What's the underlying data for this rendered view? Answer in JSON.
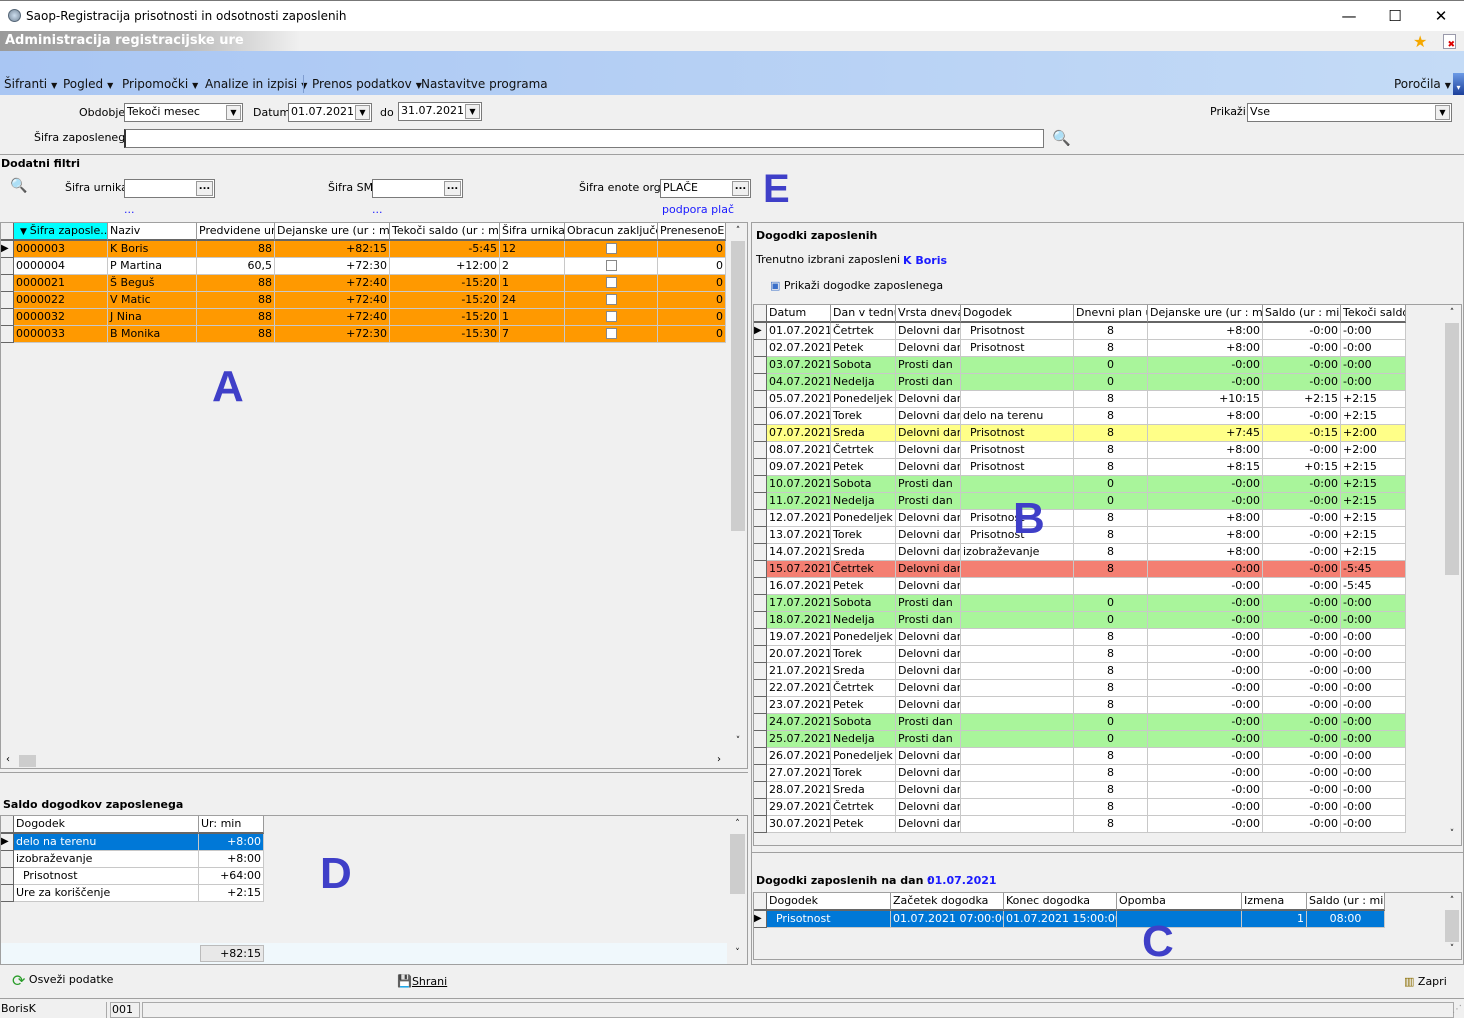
{
  "window": {
    "title": "Saop-Registracija prisotnosti in odsotnosti zaposlenih",
    "minimize": "—",
    "maximize": "☐",
    "close": "✕"
  },
  "header": {
    "title": "Administracija registracijske ure"
  },
  "menu": {
    "items": [
      "Šifranti",
      "Pogled",
      "Pripomočki",
      "Analize in izpisi",
      "Prenos podatkov",
      "Nastavitve programa"
    ],
    "right": "Poročila"
  },
  "filters": {
    "obdobje_label": "Obdobje",
    "obdobje_value": "Tekoči mesec",
    "datum_label": "Datum",
    "datum_from": "01.07.2021",
    "do_label": "do",
    "datum_to": "31.07.2021",
    "prikazi_label": "Prikaži",
    "prikazi_value": "Vse",
    "sifra_zap_label": "Šifra zaposlenega",
    "sifra_zap_value": ""
  },
  "extra_filters": {
    "title": "Dodatni filtri",
    "urnik_label": "Šifra urnika",
    "urnik_value": "",
    "urnik_desc": "...",
    "sm_label": "Šifra SM",
    "sm_value": "",
    "sm_desc": "...",
    "enota_label": "Šifra enote org.",
    "enota_value": "PLAČE",
    "enota_desc": "podpora plač"
  },
  "annotations": {
    "a": "A",
    "b": "B",
    "c": "C",
    "d": "D",
    "e": "E"
  },
  "colors": {
    "orange": "#ff9900",
    "green": "#a9f59b",
    "yellow": "#ffff88",
    "red": "#f47f72",
    "selected": "#0078d7",
    "sort_header": "#00ffff"
  },
  "employees": {
    "columns": [
      "Šifra zaposle...",
      "Naziv",
      "Predvidene ure",
      "Dejanske ure (ur : min)",
      "Tekoči saldo (ur : min)",
      "Šifra urnika",
      "Obracun zaključen",
      "PrenesenoEP"
    ],
    "rows": [
      {
        "cells": [
          "0000003",
          "K Boris",
          "88",
          "+82:15",
          "-5:45",
          "12",
          "",
          "0"
        ],
        "color": "orange",
        "selected": true
      },
      {
        "cells": [
          "0000004",
          "P Martina",
          "60,5",
          "+72:30",
          "+12:00",
          "2",
          "",
          "0"
        ],
        "color": "white"
      },
      {
        "cells": [
          "0000021",
          "Š Beguš",
          "88",
          "+72:40",
          "-15:20",
          "1",
          "",
          "0"
        ],
        "color": "orange"
      },
      {
        "cells": [
          "0000022",
          "V Matic",
          "88",
          "+72:40",
          "-15:20",
          "24",
          "",
          "0"
        ],
        "color": "orange"
      },
      {
        "cells": [
          "0000032",
          "J Nina",
          "88",
          "+72:40",
          "-15:20",
          "1",
          "",
          "0"
        ],
        "color": "orange"
      },
      {
        "cells": [
          "0000033",
          "B Monika",
          "88",
          "+72:30",
          "-15:30",
          "7",
          "",
          "0"
        ],
        "color": "orange"
      }
    ]
  },
  "saldo": {
    "title": "Saldo dogodkov zaposlenega",
    "columns": [
      "Dogodek",
      "Ur: min"
    ],
    "rows": [
      {
        "cells": [
          "delo na terenu",
          "+8:00"
        ],
        "selected": true
      },
      {
        "cells": [
          "izobraževanje",
          "+8:00"
        ]
      },
      {
        "cells": [
          "  Prisotnost",
          "+64:00"
        ]
      },
      {
        "cells": [
          "Ure za koriščenje",
          "+2:15"
        ]
      }
    ],
    "total": "+82:15"
  },
  "events": {
    "title": "Dogodki zaposlenih",
    "current_label": "Trenutno izbrani zaposleni",
    "current_value": "K Boris",
    "show_button": "Prikaži dogodke zaposlenega",
    "columns": [
      "Datum",
      "Dan v tednu",
      "Vrsta dneva",
      "Dogodek",
      "Dnevni plan ur",
      "Dejanske ure (ur : min)",
      "Saldo (ur : min)",
      "Tekoči saldo"
    ],
    "rows": [
      {
        "cells": [
          "01.07.2021",
          "Četrtek",
          "Delovni dan",
          "  Prisotnost",
          "8",
          "+8:00",
          "-0:00",
          "-0:00"
        ],
        "color": "white",
        "selected": true
      },
      {
        "cells": [
          "02.07.2021",
          "Petek",
          "Delovni dan",
          "  Prisotnost",
          "8",
          "+8:00",
          "-0:00",
          "-0:00"
        ],
        "color": "white"
      },
      {
        "cells": [
          "03.07.2021",
          "Sobota",
          "Prosti dan",
          "",
          "0",
          "-0:00",
          "-0:00",
          "-0:00"
        ],
        "color": "green"
      },
      {
        "cells": [
          "04.07.2021",
          "Nedelja",
          "Prosti dan",
          "",
          "0",
          "-0:00",
          "-0:00",
          "-0:00"
        ],
        "color": "green"
      },
      {
        "cells": [
          "05.07.2021",
          "Ponedeljek",
          "Delovni dan",
          "",
          "8",
          "+10:15",
          "+2:15",
          "+2:15"
        ],
        "color": "white"
      },
      {
        "cells": [
          "06.07.2021",
          "Torek",
          "Delovni dan",
          "delo na terenu",
          "8",
          "+8:00",
          "-0:00",
          "+2:15"
        ],
        "color": "white"
      },
      {
        "cells": [
          "07.07.2021",
          "Sreda",
          "Delovni dan",
          "  Prisotnost",
          "8",
          "+7:45",
          "-0:15",
          "+2:00"
        ],
        "color": "yellow"
      },
      {
        "cells": [
          "08.07.2021",
          "Četrtek",
          "Delovni dan",
          "  Prisotnost",
          "8",
          "+8:00",
          "-0:00",
          "+2:00"
        ],
        "color": "white"
      },
      {
        "cells": [
          "09.07.2021",
          "Petek",
          "Delovni dan",
          "  Prisotnost",
          "8",
          "+8:15",
          "+0:15",
          "+2:15"
        ],
        "color": "white"
      },
      {
        "cells": [
          "10.07.2021",
          "Sobota",
          "Prosti dan",
          "",
          "0",
          "-0:00",
          "-0:00",
          "+2:15"
        ],
        "color": "green"
      },
      {
        "cells": [
          "11.07.2021",
          "Nedelja",
          "Prosti dan",
          "",
          "0",
          "-0:00",
          "-0:00",
          "+2:15"
        ],
        "color": "green"
      },
      {
        "cells": [
          "12.07.2021",
          "Ponedeljek",
          "Delovni dan",
          "  Prisotnost",
          "8",
          "+8:00",
          "-0:00",
          "+2:15"
        ],
        "color": "white"
      },
      {
        "cells": [
          "13.07.2021",
          "Torek",
          "Delovni dan",
          "  Prisotnost",
          "8",
          "+8:00",
          "-0:00",
          "+2:15"
        ],
        "color": "white"
      },
      {
        "cells": [
          "14.07.2021",
          "Sreda",
          "Delovni dan",
          "izobraževanje",
          "8",
          "+8:00",
          "-0:00",
          "+2:15"
        ],
        "color": "white"
      },
      {
        "cells": [
          "15.07.2021",
          "Četrtek",
          "Delovni dan",
          "",
          "8",
          "-0:00",
          "-0:00",
          "-5:45"
        ],
        "color": "red"
      },
      {
        "cells": [
          "16.07.2021",
          "Petek",
          "Delovni dan",
          "",
          "",
          "-0:00",
          "-0:00",
          "-5:45"
        ],
        "color": "white"
      },
      {
        "cells": [
          "17.07.2021",
          "Sobota",
          "Prosti dan",
          "",
          "0",
          "-0:00",
          "-0:00",
          "-0:00"
        ],
        "color": "green"
      },
      {
        "cells": [
          "18.07.2021",
          "Nedelja",
          "Prosti dan",
          "",
          "0",
          "-0:00",
          "-0:00",
          "-0:00"
        ],
        "color": "green"
      },
      {
        "cells": [
          "19.07.2021",
          "Ponedeljek",
          "Delovni dan",
          "",
          "8",
          "-0:00",
          "-0:00",
          "-0:00"
        ],
        "color": "white"
      },
      {
        "cells": [
          "20.07.2021",
          "Torek",
          "Delovni dan",
          "",
          "8",
          "-0:00",
          "-0:00",
          "-0:00"
        ],
        "color": "white"
      },
      {
        "cells": [
          "21.07.2021",
          "Sreda",
          "Delovni dan",
          "",
          "8",
          "-0:00",
          "-0:00",
          "-0:00"
        ],
        "color": "white"
      },
      {
        "cells": [
          "22.07.2021",
          "Četrtek",
          "Delovni dan",
          "",
          "8",
          "-0:00",
          "-0:00",
          "-0:00"
        ],
        "color": "white"
      },
      {
        "cells": [
          "23.07.2021",
          "Petek",
          "Delovni dan",
          "",
          "8",
          "-0:00",
          "-0:00",
          "-0:00"
        ],
        "color": "white"
      },
      {
        "cells": [
          "24.07.2021",
          "Sobota",
          "Prosti dan",
          "",
          "0",
          "-0:00",
          "-0:00",
          "-0:00"
        ],
        "color": "green"
      },
      {
        "cells": [
          "25.07.2021",
          "Nedelja",
          "Prosti dan",
          "",
          "0",
          "-0:00",
          "-0:00",
          "-0:00"
        ],
        "color": "green"
      },
      {
        "cells": [
          "26.07.2021",
          "Ponedeljek",
          "Delovni dan",
          "",
          "8",
          "-0:00",
          "-0:00",
          "-0:00"
        ],
        "color": "white"
      },
      {
        "cells": [
          "27.07.2021",
          "Torek",
          "Delovni dan",
          "",
          "8",
          "-0:00",
          "-0:00",
          "-0:00"
        ],
        "color": "white"
      },
      {
        "cells": [
          "28.07.2021",
          "Sreda",
          "Delovni dan",
          "",
          "8",
          "-0:00",
          "-0:00",
          "-0:00"
        ],
        "color": "white"
      },
      {
        "cells": [
          "29.07.2021",
          "Četrtek",
          "Delovni dan",
          "",
          "8",
          "-0:00",
          "-0:00",
          "-0:00"
        ],
        "color": "white"
      },
      {
        "cells": [
          "30.07.2021",
          "Petek",
          "Delovni dan",
          "",
          "8",
          "-0:00",
          "-0:00",
          "-0:00"
        ],
        "color": "white"
      }
    ]
  },
  "day_events": {
    "title": "Dogodki zaposlenih na dan :",
    "date": "01.07.2021",
    "columns": [
      "Dogodek",
      "Začetek dogodka",
      "Konec dogodka",
      "Opomba",
      "Izmena",
      "Saldo (ur : min)"
    ],
    "rows": [
      {
        "cells": [
          "  Prisotnost",
          "01.07.2021 07:00:00",
          "01.07.2021 15:00:00",
          "",
          "1",
          "08:00"
        ],
        "selected": true
      }
    ]
  },
  "buttons": {
    "refresh": "Osveži podatke",
    "save": "Shrani",
    "close": "Zapri"
  },
  "status": {
    "user": "BorisK",
    "code": "001"
  }
}
